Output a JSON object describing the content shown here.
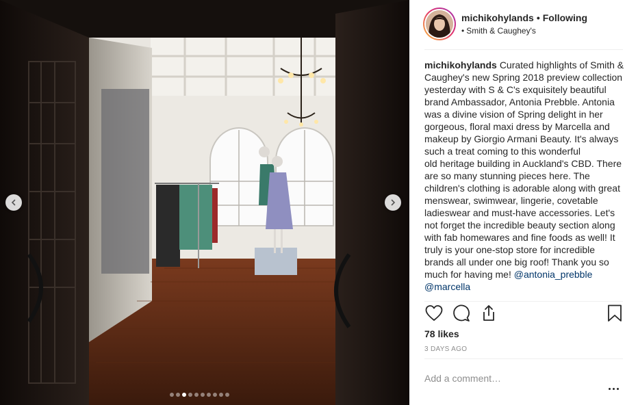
{
  "post": {
    "username": "michikohylands",
    "separator": "•",
    "follow_status": "Following",
    "location_bullet": "•",
    "location": "Smith & Caughey's"
  },
  "caption": {
    "author": "michikohylands",
    "text_1": "Curated highlights of Smith & Caughey's new Spring 2018 preview collection yesterday with S & C's exquisitely beautiful brand Ambassador, Antonia Prebble. Antonia was a divine vision of Spring delight in her gorgeous, floral maxi dress by Marcella and makeup by Giorgio Armani Beauty. It's always such a treat coming to this wonderful",
    "text_2": "old heritage building in Auckland's CBD. There are so many stunning pieces here. The children's clothing is adorable along with great menswear, swimwear, lingerie, covetable ladieswear and must-have accessories. Let's not forget the incredible beauty section along with fab homewares and fine foods as well! It truly is your one-stop store for incredible brands all under one big roof! Thank you so much for having me!",
    "mention_1": "@antonia_prebble",
    "mention_2": "@marcella"
  },
  "stats": {
    "likes": "78 likes",
    "time_ago": "3 DAYS AGO"
  },
  "comment": {
    "placeholder": "Add a comment…"
  },
  "carousel": {
    "total": 10,
    "active_index": 2
  },
  "icons": {
    "prev": "chevron-left-icon",
    "next": "chevron-right-icon",
    "like": "heart-icon",
    "comment": "speech-bubble-icon",
    "share": "share-icon",
    "save": "bookmark-icon",
    "more": "more-options-icon"
  },
  "colors": {
    "text": "#262626",
    "muted": "#8e8e8e",
    "mention": "#003569",
    "divider": "#efefef"
  }
}
